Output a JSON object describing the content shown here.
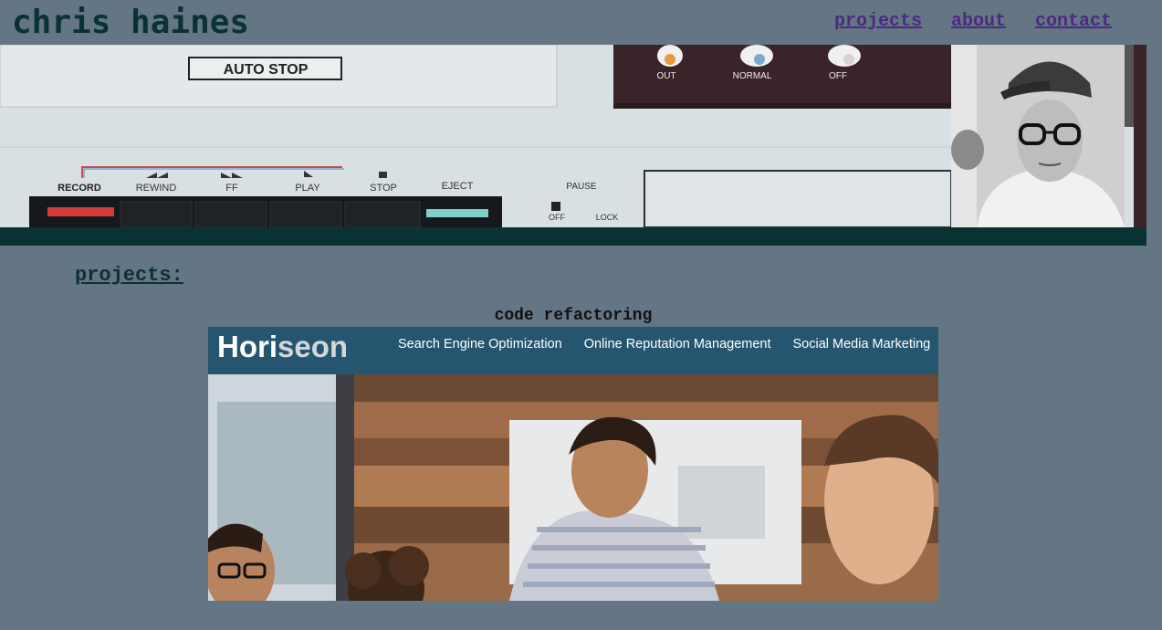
{
  "site": {
    "title": "chris haines"
  },
  "nav": {
    "items": [
      "projects",
      "about",
      "contact"
    ]
  },
  "hero": {
    "panel_labels": {
      "auto_stop": "AUTO STOP",
      "out": "OUT",
      "normal": "NORMAL",
      "off": "OFF",
      "record": "RECORD",
      "rewind": "REWIND",
      "ff": "FF",
      "play": "PLAY",
      "stop": "STOP",
      "eject": "EJECT",
      "pause": "PAUSE",
      "off2": "OFF",
      "lock": "LOCK"
    }
  },
  "projects": {
    "heading": "projects:",
    "items": [
      {
        "title": "code refactoring",
        "screenshot": {
          "logo_a": "Hori",
          "logo_b": "seon",
          "links": [
            "Search Engine Optimization",
            "Online Reputation Management",
            "Social Media Marketing"
          ]
        }
      }
    ]
  }
}
